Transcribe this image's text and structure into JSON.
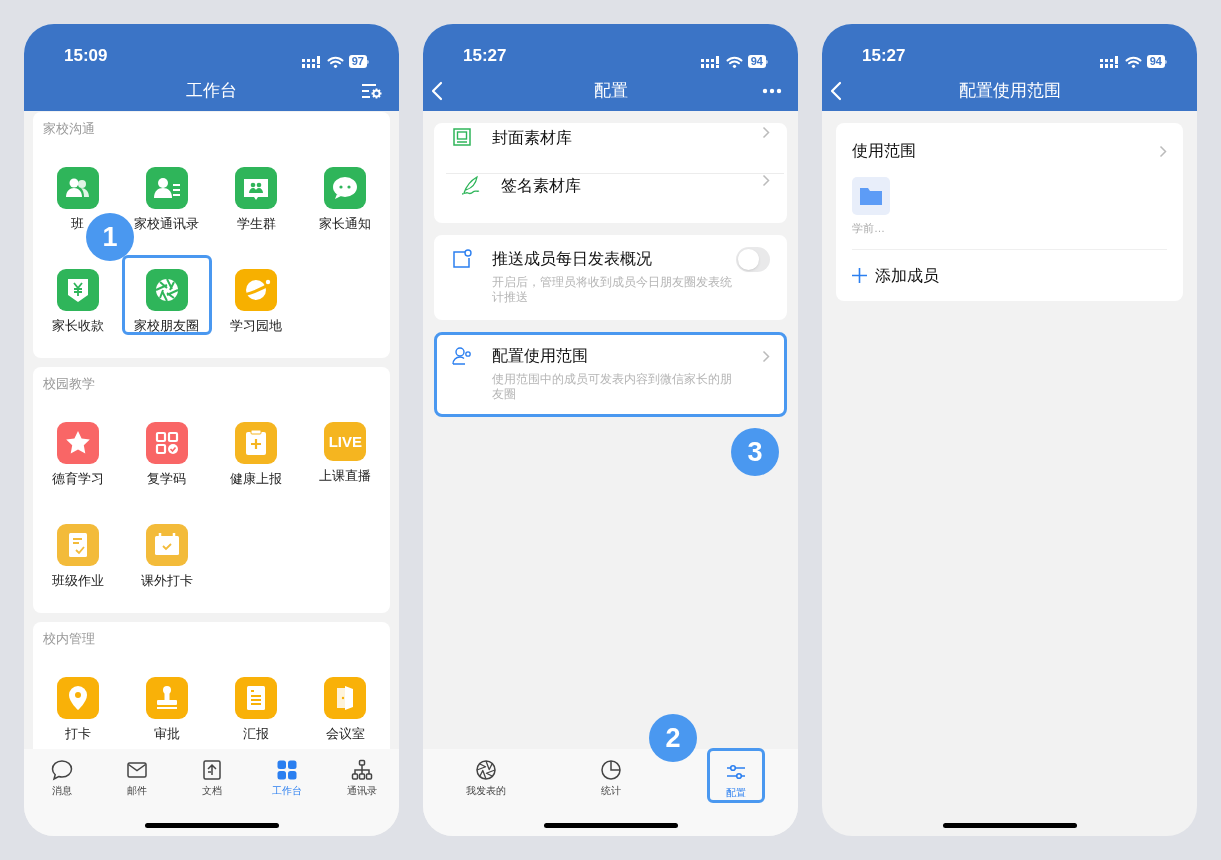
{
  "screens": [
    {
      "kind": "workbench",
      "status": {
        "time": "15:09",
        "battery": "97"
      },
      "title": "工作台",
      "sections": [
        {
          "title": "家校沟通",
          "apps": [
            {
              "label": "班",
              "color": "#2fb55a",
              "highlighted": false
            },
            {
              "label": "家校通讯录",
              "color": "#2fb55a",
              "highlighted": false
            },
            {
              "label": "学生群",
              "color": "#2fb55a",
              "highlighted": false
            },
            {
              "label": "家长通知",
              "color": "#2fb55a",
              "highlighted": false
            },
            {
              "label": "家长收款",
              "color": "#2fb55a",
              "highlighted": false
            },
            {
              "label": "家校朋友圈",
              "color": "#2fb55a",
              "highlighted": true,
              "step": "1"
            },
            {
              "label": "学习园地",
              "color": "#f7b000",
              "highlighted": false
            }
          ]
        },
        {
          "title": "校园教学",
          "apps": [
            {
              "label": "德育学习",
              "color": "#f96666",
              "highlighted": false
            },
            {
              "label": "复学码",
              "color": "#f96666",
              "highlighted": false
            },
            {
              "label": "健康上报",
              "color": "#f5b520",
              "highlighted": false
            },
            {
              "label": "上课直播",
              "color": "#f5b520",
              "highlighted": false,
              "icon_text": "LIVE"
            },
            {
              "label": "班级作业",
              "color": "#f3bb3a",
              "highlighted": false
            },
            {
              "label": "课外打卡",
              "color": "#f3bb3a",
              "highlighted": false
            }
          ]
        },
        {
          "title": "校内管理",
          "apps": [
            {
              "label": "打卡",
              "color": "#f9b108",
              "highlighted": false
            },
            {
              "label": "审批",
              "color": "#f9b108",
              "highlighted": false
            },
            {
              "label": "汇报",
              "color": "#f9b108",
              "highlighted": false
            },
            {
              "label": "会议室",
              "color": "#f9b108",
              "highlighted": false
            }
          ]
        }
      ],
      "tabs": [
        {
          "label": "消息",
          "selected": false
        },
        {
          "label": "邮件",
          "selected": false
        },
        {
          "label": "文档",
          "selected": false
        },
        {
          "label": "工作台",
          "selected": true
        },
        {
          "label": "通讯录",
          "selected": false
        }
      ]
    },
    {
      "kind": "config",
      "status": {
        "time": "15:27",
        "battery": "94"
      },
      "title": "配置",
      "groups": [
        {
          "highlighted": false,
          "rows": [
            {
              "kind": "link",
              "label": "封面素材库"
            },
            {
              "kind": "link",
              "label": "签名素材库"
            }
          ]
        },
        {
          "highlighted": false,
          "rows": [
            {
              "kind": "toggle",
              "label": "推送成员每日发表概况",
              "on": false,
              "description": "开启后，管理员将收到成员今日朋友圈发表统计推送"
            }
          ]
        },
        {
          "highlighted": true,
          "step": "3",
          "rows": [
            {
              "kind": "link",
              "label": "配置使用范围",
              "description": "使用范围中的成员可发表内容到微信家长的朋友圈"
            }
          ]
        }
      ],
      "tabs": [
        {
          "label": "我发表的",
          "selected": false,
          "highlighted": false
        },
        {
          "label": "统计",
          "selected": false,
          "highlighted": false
        },
        {
          "label": "配置",
          "selected": true,
          "highlighted": true,
          "step": "2"
        }
      ]
    },
    {
      "kind": "scope",
      "status": {
        "time": "15:27",
        "battery": "94"
      },
      "title": "配置使用范围",
      "section": "使用范围",
      "members": [
        {
          "label": "学前…"
        }
      ],
      "add_label": "添加成员"
    }
  ]
}
